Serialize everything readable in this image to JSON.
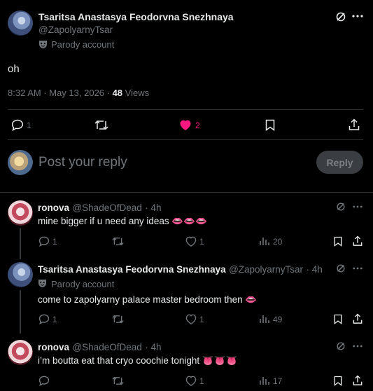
{
  "main_post": {
    "author_name": "Tsaritsa Anastasya Feodorvna Snezhnaya",
    "author_handle": "@ZapolyarnyTsar",
    "label_icon": "parody-mask",
    "label": "Parody account",
    "text": "oh",
    "timestamp": "8:32 AM · May 13, 2026 · ",
    "views_count": "48",
    "views_label": "Views",
    "reply_count": "1",
    "like_count": "2",
    "accent_like": "#f91880"
  },
  "composer": {
    "placeholder": "Post your reply",
    "reply_button": "Reply"
  },
  "replies": [
    {
      "author_name": "ronova",
      "author_handle": "@ShadeOfDead",
      "time": "· 4h",
      "text": "mine bigger if u need any ideas 👄👄👄",
      "reply_count": "1",
      "like_count": "1",
      "views_count": "20"
    },
    {
      "author_name": "Tsaritsa Anastasya Feodorvna Snezhnaya",
      "author_handle": "@ZapolyarnyTsar",
      "time": "· 4h",
      "label": "Parody account",
      "text": "come to zapolyarny palace master bedroom then 👄",
      "reply_count": "1",
      "like_count": "1",
      "views_count": "49"
    },
    {
      "author_name": "ronova",
      "author_handle": "@ShadeOfDead",
      "time": "· 4h",
      "text": "i’m boutta eat that cryo coochie tonight 👅👅👅",
      "like_count": "1",
      "views_count": "17"
    }
  ]
}
